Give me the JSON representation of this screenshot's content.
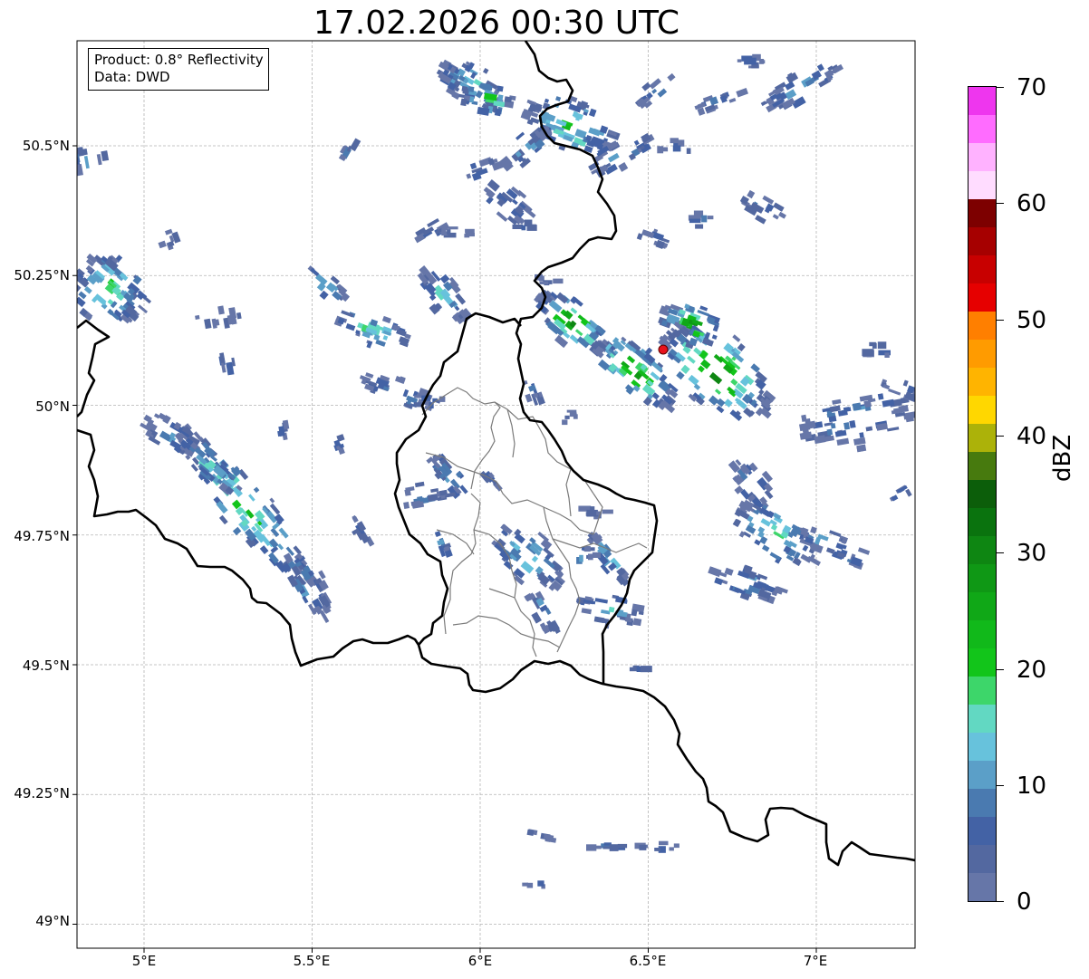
{
  "title": "17.02.2026 00:30 UTC",
  "infobox": {
    "product": "Product: 0.8° Reflectivity",
    "data": "Data: DWD"
  },
  "map": {
    "lat_labels": [
      "50.5°N",
      "50.25°N",
      "50°N",
      "49.75°N",
      "49.5°N",
      "49.25°N",
      "49°N"
    ],
    "lon_labels": [
      "5°E",
      "5.5°E",
      "6°E",
      "6.5°E",
      "7°E"
    ],
    "extent": {
      "lon_min": 4.8,
      "lon_max": 7.3,
      "lat_min": 48.95,
      "lat_max": 50.7
    },
    "radar_site": {
      "lon": 6.548,
      "lat": 50.109,
      "color": "#e8121b"
    },
    "border_color": "#000000",
    "district_color": "#7a7a7a",
    "grid_color": "#b4b4b4"
  },
  "colorbar": {
    "title": "dBZ",
    "min": 0,
    "max": 70,
    "tick_labels": [
      "0",
      "10",
      "20",
      "30",
      "40",
      "50",
      "60",
      "70"
    ],
    "colors": [
      "#6676a8",
      "#5368a0",
      "#4362a5",
      "#4a7ab0",
      "#5b9fc8",
      "#67c2dc",
      "#62d8c2",
      "#3dd66a",
      "#12c51a",
      "#11b91a",
      "#10a817",
      "#0f9815",
      "#0e8612",
      "#0a730e",
      "#0c5e0a",
      "#477a0e",
      "#acb209",
      "#ffd700",
      "#ffb400",
      "#ff9b00",
      "#ff7f00",
      "#e60000",
      "#c80000",
      "#a60000",
      "#7d0000",
      "#ffdcff",
      "#ffb2ff",
      "#ff6cff",
      "#ee36ee"
    ]
  }
}
